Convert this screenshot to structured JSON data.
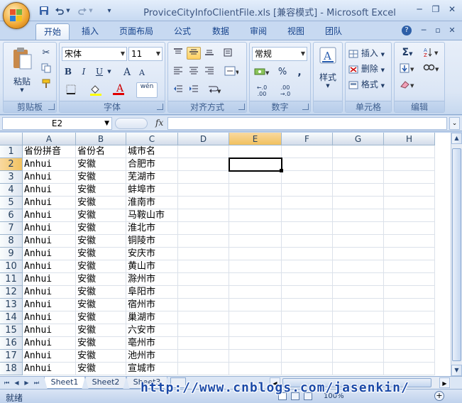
{
  "window": {
    "title": "ProviceCityInfoClientFile.xls  [兼容模式] - Microsoft Excel",
    "minimize": "─",
    "restore": "❐",
    "close": "✕"
  },
  "quick_access": {
    "save_icon": "save-icon",
    "undo_icon": "undo-icon",
    "redo_icon": "redo-icon"
  },
  "ribbon_tabs": [
    "开始",
    "插入",
    "页面布局",
    "公式",
    "数据",
    "审阅",
    "视图",
    "团队"
  ],
  "active_tab": "开始",
  "ribbon": {
    "clipboard": {
      "label": "剪贴板",
      "paste": "粘贴"
    },
    "font": {
      "label": "字体",
      "font_name": "宋体",
      "font_size": "11",
      "bold": "B",
      "italic": "I",
      "underline": "U",
      "grow": "A",
      "shrink": "A",
      "font_color": "A",
      "phonetic": "wén"
    },
    "alignment": {
      "label": "对齐方式"
    },
    "number": {
      "label": "数字",
      "format": "常规",
      "percent": "%",
      "comma": ","
    },
    "styles": {
      "label": "样式",
      "button": "样式"
    },
    "cells": {
      "label": "单元格",
      "insert": "插入",
      "delete": "删除",
      "format": "格式"
    },
    "editing": {
      "label": "编辑"
    }
  },
  "formula_bar": {
    "name_box": "E2",
    "fx": "fx",
    "formula": ""
  },
  "sheet": {
    "columns": [
      "A",
      "B",
      "C",
      "D",
      "E",
      "F",
      "G",
      "H"
    ],
    "active_column": "E",
    "active_row": "2",
    "selected_cell": "E2",
    "rows": [
      {
        "num": "1",
        "a": "省份拼音",
        "b": "省份名",
        "c": "城市名"
      },
      {
        "num": "2",
        "a": "Anhui",
        "b": "安徽",
        "c": "合肥市"
      },
      {
        "num": "3",
        "a": "Anhui",
        "b": "安徽",
        "c": "芜湖市"
      },
      {
        "num": "4",
        "a": "Anhui",
        "b": "安徽",
        "c": "蚌埠市"
      },
      {
        "num": "5",
        "a": "Anhui",
        "b": "安徽",
        "c": "淮南市"
      },
      {
        "num": "6",
        "a": "Anhui",
        "b": "安徽",
        "c": "马鞍山市"
      },
      {
        "num": "7",
        "a": "Anhui",
        "b": "安徽",
        "c": "淮北市"
      },
      {
        "num": "8",
        "a": "Anhui",
        "b": "安徽",
        "c": "铜陵市"
      },
      {
        "num": "9",
        "a": "Anhui",
        "b": "安徽",
        "c": "安庆市"
      },
      {
        "num": "10",
        "a": "Anhui",
        "b": "安徽",
        "c": "黄山市"
      },
      {
        "num": "11",
        "a": "Anhui",
        "b": "安徽",
        "c": "滁州市"
      },
      {
        "num": "12",
        "a": "Anhui",
        "b": "安徽",
        "c": "阜阳市"
      },
      {
        "num": "13",
        "a": "Anhui",
        "b": "安徽",
        "c": "宿州市"
      },
      {
        "num": "14",
        "a": "Anhui",
        "b": "安徽",
        "c": "巢湖市"
      },
      {
        "num": "15",
        "a": "Anhui",
        "b": "安徽",
        "c": "六安市"
      },
      {
        "num": "16",
        "a": "Anhui",
        "b": "安徽",
        "c": "亳州市"
      },
      {
        "num": "17",
        "a": "Anhui",
        "b": "安徽",
        "c": "池州市"
      },
      {
        "num": "18",
        "a": "Anhui",
        "b": "安徽",
        "c": "宣城市"
      }
    ]
  },
  "sheet_tabs": [
    "Sheet1",
    "Sheet2",
    "Sheet3"
  ],
  "active_sheet": "Sheet1",
  "status": {
    "text": "就绪",
    "zoom": "100%"
  },
  "watermark": "http://www.cnblogs.com/jasenkin/"
}
